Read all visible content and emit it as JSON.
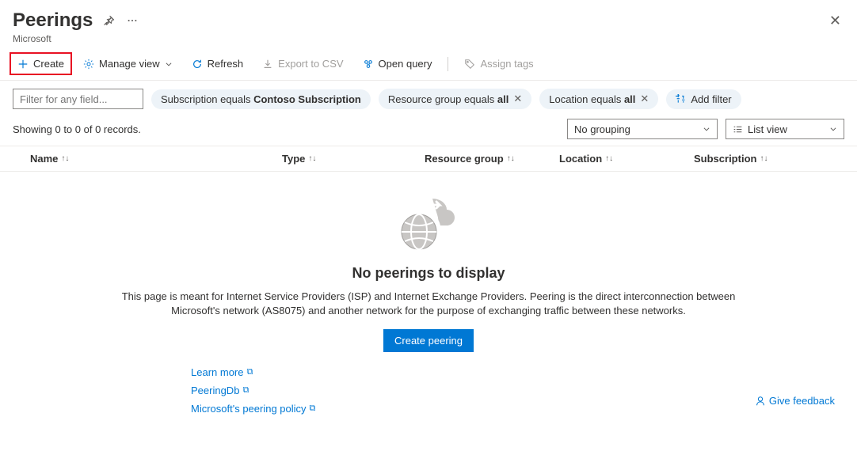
{
  "header": {
    "title": "Peerings",
    "subtitle": "Microsoft"
  },
  "toolbar": {
    "create": "Create",
    "manage_view": "Manage view",
    "refresh": "Refresh",
    "export_csv": "Export to CSV",
    "open_query": "Open query",
    "assign_tags": "Assign tags"
  },
  "filter": {
    "placeholder": "Filter for any field...",
    "subscription_prefix": "Subscription equals ",
    "subscription_value": "Contoso Subscription",
    "resource_group_prefix": "Resource group equals ",
    "resource_group_value": "all",
    "location_prefix": "Location equals ",
    "location_value": "all",
    "add_filter": "Add filter"
  },
  "status": {
    "showing": "Showing 0 to 0 of 0 records.",
    "grouping": "No grouping",
    "view": "List view"
  },
  "columns": {
    "name": "Name",
    "type": "Type",
    "resource_group": "Resource group",
    "location": "Location",
    "subscription": "Subscription"
  },
  "empty": {
    "title": "No peerings to display",
    "description": "This page is meant for Internet Service Providers (ISP) and Internet Exchange Providers. Peering is the direct interconnection between Microsoft's network (AS8075) and another network for the purpose of exchanging traffic between these networks.",
    "create_button": "Create peering",
    "learn_more": "Learn more",
    "peeringdb": "PeeringDb",
    "ms_policy": "Microsoft's peering policy",
    "feedback": "Give feedback"
  }
}
